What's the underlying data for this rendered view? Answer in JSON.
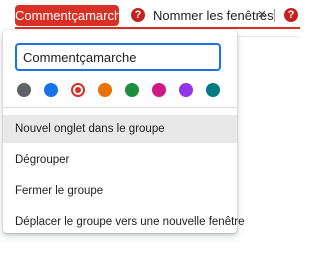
{
  "tabstrip": {
    "group_label": "Commentçamarche",
    "group_color": "#d93025",
    "tabs": [
      {
        "title": "Nommer les fenêtres",
        "favicon": "question-mark-icon"
      },
      {
        "title": "",
        "favicon": "question-mark-icon"
      }
    ],
    "close_glyph": "×"
  },
  "group_editor": {
    "name_value": "Commentçamarche",
    "colors": [
      {
        "name": "grey",
        "hex": "#5f6368"
      },
      {
        "name": "blue",
        "hex": "#1a73e8"
      },
      {
        "name": "red",
        "hex": "#d93025",
        "selected": true
      },
      {
        "name": "orange",
        "hex": "#e8710a"
      },
      {
        "name": "green",
        "hex": "#1e8e3e"
      },
      {
        "name": "pink",
        "hex": "#d01884"
      },
      {
        "name": "purple",
        "hex": "#9334e6"
      },
      {
        "name": "cyan",
        "hex": "#007b83"
      }
    ],
    "menu_items": [
      "Nouvel onglet dans le groupe",
      "Dégrouper",
      "Fermer le groupe",
      "Déplacer le groupe vers une nouvelle fenêtre"
    ]
  }
}
